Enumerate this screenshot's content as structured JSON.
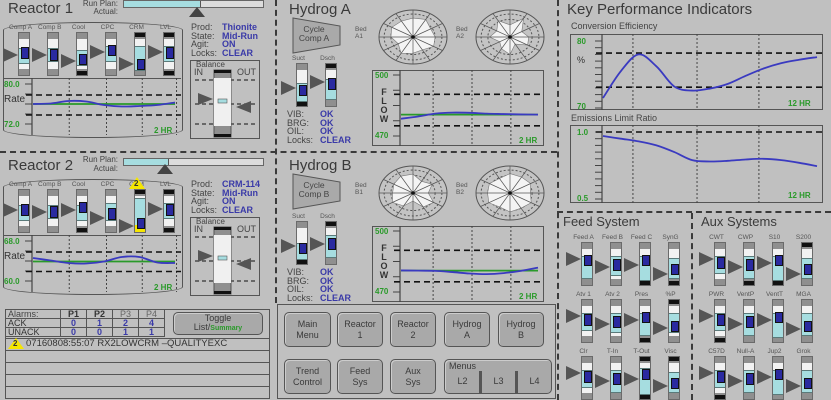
{
  "colors": {
    "background": "#c0c0c0",
    "value_blue": "#3a3aa8",
    "axis_green": "#2a9a2a",
    "trend_blue": "#3a3ac0",
    "setpoint_green": "#2a9a2a",
    "gauge_cyan": "#a6dde0",
    "alarm_yellow": "#f5e600"
  },
  "reactor1": {
    "title": "Reactor 1",
    "run_plan_label": "Run Plan:",
    "actual_label": "Actual:",
    "run_plan_progress": 0.55,
    "actual_progress": 0.53,
    "info": [
      {
        "label": "Prod:",
        "value": "Thionite"
      },
      {
        "label": "State:",
        "value": "Mid-Run"
      },
      {
        "label": "Agit:",
        "value": "ON"
      },
      {
        "label": "Locks:",
        "value": "CLEAR"
      }
    ],
    "balance": {
      "label": "Balance",
      "in": "IN",
      "out": "OUT"
    },
    "gauges": [
      {
        "label": "Comp A",
        "band": [
          0.35,
          0.7
        ],
        "marker": 0.45,
        "ptr": 0.55
      },
      {
        "label": "Comp B",
        "band": [
          0.35,
          0.65
        ],
        "marker": 0.5,
        "ptr": 0.55
      },
      {
        "label": "Cool",
        "band": [
          0.4,
          0.75
        ],
        "marker": 0.6,
        "ptr": 0.7,
        "capBot": true
      },
      {
        "label": "CPC",
        "band": [
          0.3,
          0.65
        ],
        "marker": 0.4,
        "ptr": 0.47
      },
      {
        "label": "CRM",
        "band": [
          0.3,
          0.85
        ],
        "marker": 0.72,
        "ptr": 0.77,
        "capTop": true
      },
      {
        "label": "LVL",
        "band": [
          0.3,
          0.65
        ],
        "marker": 0.45,
        "ptr": 0.47,
        "capTop": true,
        "capBot": true
      }
    ],
    "trend": {
      "label": "Rate",
      "ymax_label": "80.0",
      "ymin_label": "72.0",
      "span": "2 HR",
      "ylim": [
        72,
        80
      ],
      "limits": [
        77.8,
        73.8
      ],
      "setpoint": 76,
      "values": [
        76.0,
        76.1,
        76.6,
        76.5,
        75.8,
        75.5,
        75.6,
        75.8,
        76.3
      ]
    }
  },
  "reactor2": {
    "title": "Reactor 2",
    "run_plan_label": "Run Plan:",
    "actual_label": "Actual:",
    "run_plan_progress": 0.32,
    "actual_progress": 0.3,
    "info": [
      {
        "label": "Prod:",
        "value": "CRM-114"
      },
      {
        "label": "State:",
        "value": "Mid-Run"
      },
      {
        "label": "Agit:",
        "value": "ON"
      },
      {
        "label": "Locks:",
        "value": "CLEAR"
      }
    ],
    "balance": {
      "label": "Balance",
      "in": "IN",
      "out": "OUT"
    },
    "gauges": [
      {
        "label": "Comp A",
        "band": [
          0.35,
          0.7
        ],
        "marker": 0.45,
        "ptr": 0.5
      },
      {
        "label": "Comp B",
        "band": [
          0.35,
          0.65
        ],
        "marker": 0.5,
        "ptr": 0.55
      },
      {
        "label": "Cool",
        "band": [
          0.35,
          0.7
        ],
        "marker": 0.4,
        "ptr": 0.5,
        "capBot": true
      },
      {
        "label": "CPC",
        "band": [
          0.3,
          0.7
        ],
        "marker": 0.55,
        "ptr": 0.7
      },
      {
        "label": "CRM",
        "band": [
          0.2,
          0.85
        ],
        "marker": 0.78,
        "ptr": 0.88,
        "capTop": true,
        "yellowBot": true,
        "alarm": "2"
      },
      {
        "label": "LVL",
        "band": [
          0.3,
          0.65
        ],
        "marker": 0.45,
        "ptr": 0.47,
        "capTop": true,
        "capBot": true
      }
    ],
    "trend": {
      "label": "Rate",
      "ymax_label": "68.0",
      "ymin_label": "60.0",
      "span": "2 HR",
      "ylim": [
        60,
        68
      ],
      "limits": [
        65.8,
        61.9
      ],
      "setpoint": 63.9,
      "values": [
        64.6,
        64.1,
        63.6,
        63.5,
        63.9,
        64.8,
        64.8,
        63.7,
        63.6
      ]
    }
  },
  "alarms": {
    "header": [
      "Alarms:",
      "P1",
      "P2",
      "P3",
      "P4"
    ],
    "rows": [
      {
        "label": "ACK",
        "values": [
          "0",
          "1",
          "2",
          "4"
        ]
      },
      {
        "label": "UNACK",
        "values": [
          "0",
          "0",
          "1",
          "1"
        ]
      }
    ],
    "toggle": {
      "line1": "Toggle",
      "line2a": "List/",
      "line2b": "Summary"
    },
    "messages": [
      {
        "priority": "2",
        "text": "07160808:55:07 RX2LOWCRM –QUALITYEXC"
      }
    ]
  },
  "hydrogA": {
    "title": "Hydrog A",
    "compressor": [
      "Cycle",
      "Comp A"
    ],
    "beds": [
      {
        "label": [
          "Bed",
          "A1"
        ],
        "profile": [
          0.7,
          0.75,
          0.6,
          0.65,
          0.7,
          0.55,
          0.6,
          0.7,
          0.5,
          0.65,
          0.72,
          0.68
        ]
      },
      {
        "label": [
          "Bed",
          "A2"
        ],
        "profile": [
          0.45,
          0.8,
          0.4,
          0.55,
          0.6,
          0.3,
          0.65,
          0.5,
          0.35,
          0.6,
          0.45,
          0.7
        ]
      }
    ],
    "gauges": [
      {
        "label": "Suct",
        "band": [
          0.45,
          0.85
        ],
        "marker": 0.6,
        "ptr": 0.6,
        "capBot": true
      },
      {
        "label": "Dsch",
        "band": [
          0.35,
          0.8
        ],
        "marker": 0.45,
        "ptr": 0.45,
        "capTop": true
      }
    ],
    "status": [
      {
        "label": "VIB:",
        "value": "OK"
      },
      {
        "label": "BRG:",
        "value": "OK"
      },
      {
        "label": "OIL:",
        "value": "OK"
      },
      {
        "label": "Locks:",
        "value": "CLEAR"
      }
    ],
    "trend": {
      "label": "FLOW",
      "ymax_label": "500",
      "ymin_label": "470",
      "span": "2 HR",
      "ylim": [
        470,
        500
      ],
      "limits": [
        490.5,
        475
      ],
      "setpoint": 480.5,
      "values": [
        478.5,
        479.6,
        481,
        481.5,
        481.4,
        481,
        480.8,
        480.6,
        480.5
      ]
    }
  },
  "hydrogB": {
    "title": "Hydrog B",
    "compressor": [
      "Cycle",
      "Comp B"
    ],
    "beds": [
      {
        "label": [
          "Bed",
          "B1"
        ],
        "profile": [
          0.7,
          0.5,
          0.65,
          0.45,
          0.7,
          0.6,
          0.3,
          0.55,
          0.7,
          0.6,
          0.65,
          0.72
        ]
      },
      {
        "label": [
          "Bed",
          "B2"
        ],
        "profile": [
          0.72,
          0.68,
          0.7,
          0.6,
          0.72,
          0.65,
          0.7,
          0.6,
          0.72,
          0.66,
          0.7,
          0.62
        ]
      }
    ],
    "gauges": [
      {
        "label": "Suct",
        "band": [
          0.5,
          0.85
        ],
        "marker": 0.6,
        "ptr": 0.6,
        "capBot": true
      },
      {
        "label": "Dsch",
        "band": [
          0.3,
          0.8
        ],
        "marker": 0.5,
        "ptr": 0.55,
        "capTop": true
      }
    ],
    "status": [
      {
        "label": "VIB:",
        "value": "OK"
      },
      {
        "label": "BRG:",
        "value": "OK"
      },
      {
        "label": "OIL:",
        "value": "OK"
      },
      {
        "label": "Locks:",
        "value": "CLEAR"
      }
    ],
    "trend": {
      "label": "FLOW",
      "ymax_label": "500",
      "ymin_label": "470",
      "span": "2 HR",
      "ylim": [
        470,
        500
      ],
      "limits": [
        490.5,
        475
      ],
      "setpoint": 480.5,
      "values": [
        480.6,
        480.5,
        480.4,
        479.8,
        479.1,
        478.8,
        479.3,
        480.4,
        482
      ]
    }
  },
  "nav": {
    "row1": [
      {
        "label": [
          "Main",
          "Menu"
        ]
      },
      {
        "label": [
          "Reactor",
          "1"
        ]
      },
      {
        "label": [
          "Reactor",
          "2"
        ]
      },
      {
        "label": [
          "Hydrog",
          "A"
        ]
      },
      {
        "label": [
          "Hydrog",
          "B"
        ]
      }
    ],
    "row2": [
      {
        "label": [
          "Trend",
          "Control"
        ]
      },
      {
        "label": [
          "Feed",
          "Sys"
        ]
      },
      {
        "label": [
          "Aux",
          "Sys"
        ]
      }
    ],
    "menus": {
      "label": "Menus",
      "levels": [
        "L2",
        "L3",
        "L4"
      ]
    }
  },
  "kpi": {
    "title": "Key Performance Indicators",
    "conversion": {
      "title": "Conversion Efficiency",
      "unit": "%",
      "ymax_label": "80",
      "ymin_label": "70",
      "span": "12 HR",
      "ylim": [
        70,
        80
      ],
      "limits": [
        78.2,
        73.1
      ],
      "values": [
        71.5,
        75.5,
        78,
        76.2,
        73.2,
        72.6,
        72.9,
        73.6,
        74.8,
        75.9,
        76.7,
        77.2,
        77.6
      ]
    },
    "emissions": {
      "title": "Emissions Limit Ratio",
      "ymax_label": "1.0",
      "ymin_label": "0.5",
      "span": "12 HR",
      "ylim": [
        0.5,
        1.0
      ],
      "limits": [
        1.0
      ],
      "values": [
        0.97,
        0.95,
        0.93,
        0.9,
        0.85,
        0.79,
        0.78,
        0.785,
        0.795,
        0.8,
        0.79,
        0.77,
        0.745
      ]
    }
  },
  "feed": {
    "title": "Feed System",
    "rows": [
      [
        {
          "label": "Feed A",
          "band": [
            0.3,
            0.8
          ],
          "marker": 0.4,
          "ptr": 0.4
        },
        {
          "label": "Feed B",
          "band": [
            0.3,
            0.75
          ],
          "marker": 0.5,
          "ptr": 0.6
        },
        {
          "label": "Feed C",
          "band": [
            0.3,
            0.85
          ],
          "marker": 0.4,
          "ptr": 0.55,
          "capBot": true
        },
        {
          "label": "SynG",
          "band": [
            0.35,
            0.8
          ],
          "marker": 0.6,
          "ptr": 0.75,
          "capBot": true
        }
      ],
      [
        {
          "label": "Atv 1",
          "band": [
            0.3,
            0.7
          ],
          "marker": 0.45,
          "ptr": 0.4
        },
        {
          "label": "Atv 2",
          "band": [
            0.3,
            0.75
          ],
          "marker": 0.5,
          "ptr": 0.6
        },
        {
          "label": "Pres",
          "band": [
            0.3,
            0.8
          ],
          "marker": 0.4,
          "ptr": 0.5,
          "capBot": true
        },
        {
          "label": "%P",
          "band": [
            0.3,
            0.75
          ],
          "marker": 0.6,
          "ptr": 0.7,
          "capTop": true
        }
      ],
      [
        {
          "label": "Clr",
          "band": [
            0.3,
            0.7
          ],
          "marker": 0.45,
          "ptr": 0.4
        },
        {
          "label": "T-In",
          "band": [
            0.3,
            0.8
          ],
          "marker": 0.5,
          "ptr": 0.6
        },
        {
          "label": "T-Out",
          "band": [
            0.25,
            0.85
          ],
          "marker": 0.4,
          "ptr": 0.55,
          "capTop": true,
          "capBot": true
        },
        {
          "label": "Visc",
          "band": [
            0.35,
            0.8
          ],
          "marker": 0.6,
          "ptr": 0.72,
          "capTop": true
        }
      ]
    ]
  },
  "aux": {
    "title": "Aux Systems",
    "rows": [
      [
        {
          "label": "CWT",
          "band": [
            0.3,
            0.7
          ],
          "marker": 0.45,
          "ptr": 0.4
        },
        {
          "label": "CWP",
          "band": [
            0.3,
            0.8
          ],
          "marker": 0.5,
          "ptr": 0.6,
          "capBot": true
        },
        {
          "label": "S10",
          "band": [
            0.3,
            0.85
          ],
          "marker": 0.4,
          "ptr": 0.5,
          "capBot": true
        },
        {
          "label": "S200",
          "band": [
            0.35,
            0.8
          ],
          "marker": 0.6,
          "ptr": 0.75,
          "capTop": true
        }
      ],
      [
        {
          "label": "PWR",
          "band": [
            0.3,
            0.7
          ],
          "marker": 0.45,
          "ptr": 0.4,
          "capBot": true
        },
        {
          "label": "VentP",
          "band": [
            0.3,
            0.8
          ],
          "marker": 0.5,
          "ptr": 0.6
        },
        {
          "label": "VentT",
          "band": [
            0.3,
            0.85
          ],
          "marker": 0.4,
          "ptr": 0.5
        },
        {
          "label": "MGA",
          "band": [
            0.3,
            0.8
          ],
          "marker": 0.6,
          "ptr": 0.72
        }
      ],
      [
        {
          "label": "C57D",
          "band": [
            0.3,
            0.7
          ],
          "marker": 0.45,
          "ptr": 0.4,
          "capBot": true
        },
        {
          "label": "Null-A",
          "band": [
            0.3,
            0.8
          ],
          "marker": 0.5,
          "ptr": 0.6
        },
        {
          "label": "Jup2",
          "band": [
            0.3,
            0.85
          ],
          "marker": 0.4,
          "ptr": 0.5
        },
        {
          "label": "Grok",
          "band": [
            0.3,
            0.8
          ],
          "marker": 0.6,
          "ptr": 0.72
        }
      ]
    ]
  }
}
